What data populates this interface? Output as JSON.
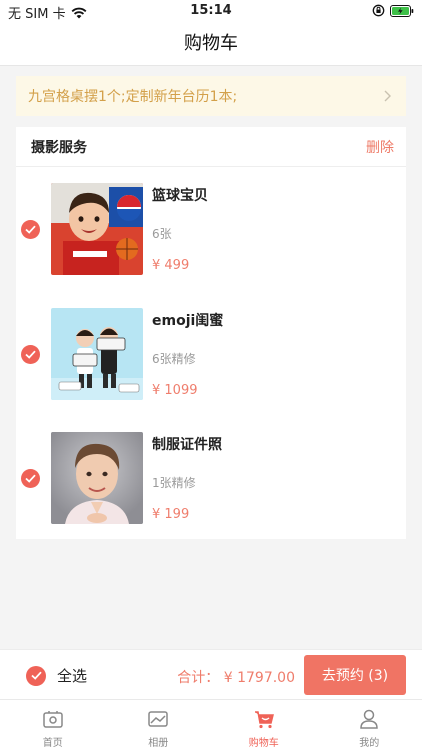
{
  "status": {
    "carrier": "无 SIM 卡",
    "time": "15:14"
  },
  "nav": {
    "title": "购物车"
  },
  "notice": {
    "text": "九宫格桌摆1个;定制新年台历1本;"
  },
  "section": {
    "title": "摄影服务",
    "delete_label": "删除"
  },
  "items": [
    {
      "name": "篮球宝贝",
      "desc": "6张",
      "price": "¥ 499",
      "checked": true
    },
    {
      "name": "emoji闺蜜",
      "desc": "6张精修",
      "price": "¥ 1099",
      "checked": true
    },
    {
      "name": "制服证件照",
      "desc": "1张精修",
      "price": "¥ 199",
      "checked": true
    }
  ],
  "bottom": {
    "select_all_label": "全选",
    "total_label": "合计：",
    "total_value": "¥ 1797.00",
    "checkout_label": "去预约 (3)"
  },
  "tabs": [
    {
      "label": "首页",
      "icon": "home-icon",
      "active": false
    },
    {
      "label": "相册",
      "icon": "album-icon",
      "active": false
    },
    {
      "label": "购物车",
      "icon": "cart-icon",
      "active": true
    },
    {
      "label": "我的",
      "icon": "profile-icon",
      "active": false
    }
  ],
  "colors": {
    "accent": "#ef6257",
    "price": "#ef7d6c",
    "notice_bg": "#fdf8e7",
    "notice_text": "#d3a04a"
  }
}
